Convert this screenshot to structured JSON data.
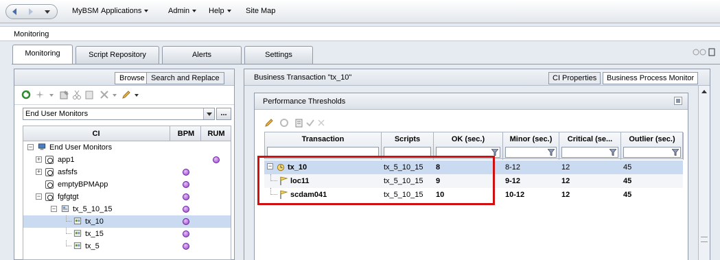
{
  "menubar": {
    "items": [
      {
        "label": "MyBSM",
        "caret": false
      },
      {
        "label": "Applications",
        "caret": true
      },
      {
        "label": "Admin",
        "caret": true
      },
      {
        "label": "Help",
        "caret": true
      },
      {
        "label": "Site Map",
        "caret": false
      }
    ]
  },
  "module": {
    "title": "Monitoring"
  },
  "tabs": [
    {
      "label": "Monitoring",
      "active": true
    },
    {
      "label": "Script Repository",
      "active": false
    },
    {
      "label": "Alerts",
      "active": false
    },
    {
      "label": "Settings",
      "active": false
    }
  ],
  "left": {
    "browse_tab": "Browse",
    "search_tab": "Search and Replace",
    "view_select": "End User Monitors",
    "ellipsis": "...",
    "columns": {
      "ci": "CI",
      "bpm": "BPM",
      "rum": "RUM"
    },
    "tree": [
      {
        "label": "End User Monitors",
        "icon": "monitors-icon",
        "depth": 0,
        "expander": "−",
        "bpm": false,
        "rum": false,
        "selected": false
      },
      {
        "label": "app1",
        "icon": "app-node-icon",
        "depth": 1,
        "expander": "+",
        "bpm": false,
        "rum": true,
        "selected": false
      },
      {
        "label": "asfsfs",
        "icon": "app-node-icon",
        "depth": 1,
        "expander": "+",
        "bpm": true,
        "rum": false,
        "selected": false
      },
      {
        "label": "emptyBPMApp",
        "icon": "app-node-icon",
        "depth": 1,
        "expander": "",
        "bpm": true,
        "rum": false,
        "selected": false
      },
      {
        "label": "fgfgtgt",
        "icon": "app-node-icon",
        "depth": 1,
        "expander": "−",
        "bpm": true,
        "rum": false,
        "selected": false
      },
      {
        "label": "tx_5_10_15",
        "icon": "script-icon",
        "depth": 2,
        "expander": "−",
        "bpm": true,
        "rum": false,
        "selected": false
      },
      {
        "label": "tx_10",
        "icon": "transaction-icon",
        "depth": 3,
        "expander": "",
        "bpm": true,
        "rum": false,
        "selected": true
      },
      {
        "label": "tx_15",
        "icon": "transaction-icon",
        "depth": 3,
        "expander": "",
        "bpm": true,
        "rum": false,
        "selected": false
      },
      {
        "label": "tx_5",
        "icon": "transaction-icon",
        "depth": 3,
        "expander": "",
        "bpm": true,
        "rum": false,
        "selected": false
      }
    ]
  },
  "right": {
    "title": "Business Transaction \"tx_10\"",
    "tab_ci": "CI Properties",
    "tab_bpm": "Business Process Monitor",
    "thresholds": {
      "title": "Performance Thresholds",
      "columns": [
        "Transaction",
        "Scripts",
        "OK (sec.)",
        "Minor (sec.)",
        "Critical (se...",
        "Outlier (sec.)"
      ],
      "rows": [
        {
          "transaction": "tx_10",
          "scripts": "tx_5_10_15",
          "ok": "8",
          "minor": "8-12",
          "critical": "12",
          "outlier": "45",
          "kind": "group",
          "selected": true
        },
        {
          "transaction": "loc11",
          "scripts": "tx_5_10_15",
          "ok": "9",
          "minor": "9-12",
          "critical": "12",
          "outlier": "45",
          "kind": "location",
          "selected": false
        },
        {
          "transaction": "scdam041",
          "scripts": "tx_5_10_15",
          "ok": "10",
          "minor": "10-12",
          "critical": "12",
          "outlier": "45",
          "kind": "location",
          "selected": false
        }
      ]
    }
  },
  "colors": {
    "accent_purple": "#9b3fd1",
    "selection": "#c9daf1",
    "highlight_red": "#d01010"
  }
}
